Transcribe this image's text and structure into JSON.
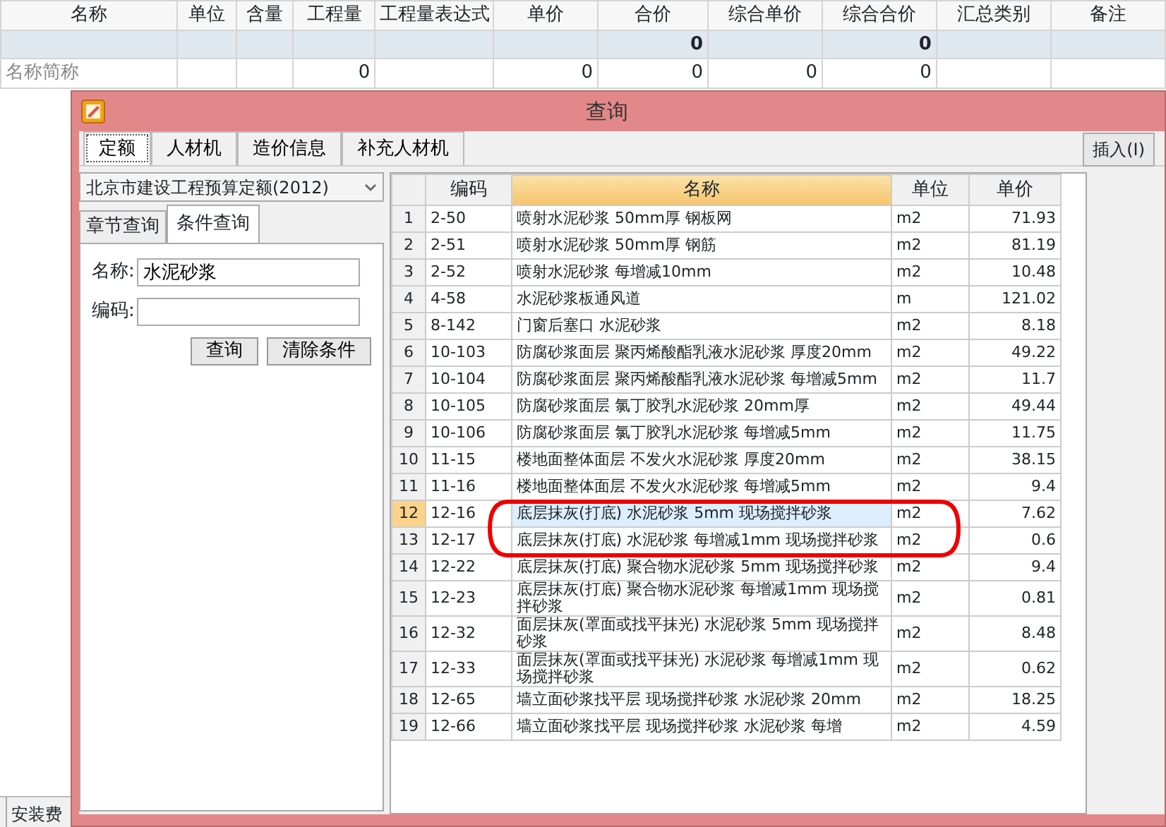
{
  "background_table": {
    "columns": [
      {
        "label": "名称"
      },
      {
        "label": "单位"
      },
      {
        "label": "含量"
      },
      {
        "label": "工程量"
      },
      {
        "label": "工程量表达式"
      },
      {
        "label": "单价"
      },
      {
        "label": "合价"
      },
      {
        "label": "综合单价"
      },
      {
        "label": "综合合价"
      },
      {
        "label": "汇总类别"
      },
      {
        "label": "备注"
      }
    ],
    "rows": [
      {
        "kind": "summary",
        "total_price": "0",
        "composite_total": "0"
      },
      {
        "kind": "item",
        "name": "名称简称",
        "quantity": "0",
        "unit_price": "0",
        "total_price": "0",
        "composite_unit_price": "0",
        "composite_total": "0"
      }
    ]
  },
  "bottom_tabs": [
    {
      "label": "安装费"
    }
  ],
  "dialog": {
    "title": "查询",
    "tabs": [
      {
        "label": "定额",
        "selected": true
      },
      {
        "label": "人材机",
        "selected": false
      },
      {
        "label": "造价信息",
        "selected": false
      },
      {
        "label": "补充人材机",
        "selected": false
      }
    ],
    "insert_button": "插入(I)",
    "library": "北京市建设工程预算定额(2012)",
    "search_tabs": [
      {
        "label": "章节查询",
        "selected": false
      },
      {
        "label": "条件查询",
        "selected": true
      }
    ],
    "fields": [
      {
        "label": "名称:",
        "value": "水泥砂浆"
      },
      {
        "label": "编码:"
      }
    ],
    "buttons": [
      "查询",
      "清除条件"
    ],
    "results": {
      "columns": [
        {
          "label": "编码",
          "sorted": false
        },
        {
          "label": "名称",
          "sorted": true
        },
        {
          "label": "单位",
          "sorted": false
        },
        {
          "label": "单价",
          "sorted": false
        }
      ],
      "rows": [
        {
          "no": "1",
          "code": "2-50",
          "name": "喷射水泥砂浆 50mm厚 钢板网",
          "unit": "m2",
          "price": "71.93",
          "selected": false
        },
        {
          "no": "2",
          "code": "2-51",
          "name": "喷射水泥砂浆 50mm厚 钢筋",
          "unit": "m2",
          "price": "81.19",
          "selected": false
        },
        {
          "no": "3",
          "code": "2-52",
          "name": "喷射水泥砂浆 每增减10mm",
          "unit": "m2",
          "price": "10.48",
          "selected": false
        },
        {
          "no": "4",
          "code": "4-58",
          "name": "水泥砂浆板通风道",
          "unit": "m",
          "price": "121.02",
          "selected": false
        },
        {
          "no": "5",
          "code": "8-142",
          "name": "门窗后塞口 水泥砂浆",
          "unit": "m2",
          "price": "8.18",
          "selected": false
        },
        {
          "no": "6",
          "code": "10-103",
          "name": "防腐砂浆面层 聚丙烯酸酯乳液水泥砂浆 厚度20mm",
          "unit": "m2",
          "price": "49.22",
          "selected": false
        },
        {
          "no": "7",
          "code": "10-104",
          "name": "防腐砂浆面层 聚丙烯酸酯乳液水泥砂浆 每增减5mm",
          "unit": "m2",
          "price": "11.7",
          "selected": false
        },
        {
          "no": "8",
          "code": "10-105",
          "name": "防腐砂浆面层 氯丁胶乳水泥砂浆 20mm厚",
          "unit": "m2",
          "price": "49.44",
          "selected": false
        },
        {
          "no": "9",
          "code": "10-106",
          "name": "防腐砂浆面层 氯丁胶乳水泥砂浆 每增减5mm",
          "unit": "m2",
          "price": "11.75",
          "selected": false
        },
        {
          "no": "10",
          "code": "11-15",
          "name": "楼地面整体面层 不发火水泥砂浆 厚度20mm",
          "unit": "m2",
          "price": "38.15",
          "selected": false
        },
        {
          "no": "11",
          "code": "11-16",
          "name": "楼地面整体面层 不发火水泥砂浆 每增减5mm",
          "unit": "m2",
          "price": "9.4",
          "selected": false
        },
        {
          "no": "12",
          "code": "12-16",
          "name": "底层抹灰(打底) 水泥砂浆 5mm 现场搅拌砂浆",
          "unit": "m2",
          "price": "7.62",
          "selected": true
        },
        {
          "no": "13",
          "code": "12-17",
          "name": "底层抹灰(打底) 水泥砂浆 每增减1mm 现场搅拌砂浆",
          "unit": "m2",
          "price": "0.6",
          "selected": false
        },
        {
          "no": "14",
          "code": "12-22",
          "name": "底层抹灰(打底) 聚合物水泥砂浆 5mm 现场搅拌砂浆",
          "unit": "m2",
          "price": "9.4",
          "selected": false
        },
        {
          "no": "15",
          "code": "12-23",
          "name": "底层抹灰(打底) 聚合物水泥砂浆 每增减1mm 现场搅拌砂浆",
          "unit": "m2",
          "price": "0.81",
          "selected": false
        },
        {
          "no": "16",
          "code": "12-32",
          "name": "面层抹灰(罩面或找平抹光) 水泥砂浆 5mm 现场搅拌砂浆",
          "unit": "m2",
          "price": "8.48",
          "selected": false
        },
        {
          "no": "17",
          "code": "12-33",
          "name": "面层抹灰(罩面或找平抹光) 水泥砂浆 每增减1mm 现场搅拌砂浆",
          "unit": "m2",
          "price": "0.62",
          "selected": false
        },
        {
          "no": "18",
          "code": "12-65",
          "name": "墙立面砂浆找平层 现场搅拌砂浆 水泥砂浆 20mm",
          "unit": "m2",
          "price": "18.25",
          "selected": false
        },
        {
          "no": "19",
          "code": "12-66",
          "name": "墙立面砂浆找平层 现场搅拌砂浆 水泥砂浆 每增",
          "unit": "m2",
          "price": "4.59",
          "selected": false
        }
      ]
    },
    "annotation": {
      "kind": "ellipse",
      "color": "#ee0000"
    }
  }
}
